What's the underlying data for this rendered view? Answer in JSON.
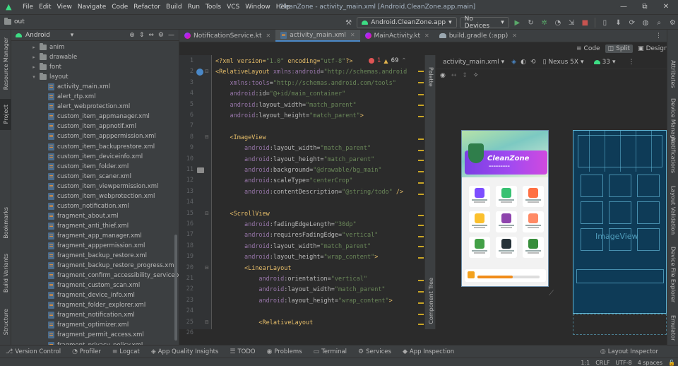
{
  "window": {
    "title": "CleanZone - activity_main.xml [Android.CleanZone.app.main]",
    "controls": [
      "—",
      "⧉",
      "✕"
    ]
  },
  "menu": [
    "File",
    "Edit",
    "View",
    "Navigate",
    "Code",
    "Refactor",
    "Build",
    "Run",
    "Tools",
    "VCS",
    "Window",
    "Help"
  ],
  "toolbar": {
    "project_name": "out",
    "run_config": "Android.CleanZone.app",
    "device": "No Devices"
  },
  "left_strip": [
    "Resource Manager",
    "Project",
    "Bookmarks",
    "Build Variants",
    "Structure"
  ],
  "right_strip": [
    "Attributes",
    "Device Manager",
    "Notifications",
    "Layout Validation",
    "Device File Explorer",
    "Emulator"
  ],
  "project": {
    "view_mode": "Android",
    "folders": [
      {
        "label": "anim",
        "expanded": false
      },
      {
        "label": "drawable",
        "expanded": false
      },
      {
        "label": "font",
        "expanded": false
      },
      {
        "label": "layout",
        "expanded": true
      }
    ],
    "files": [
      "activity_main.xml",
      "alert_rtp.xml",
      "alert_webprotection.xml",
      "custom_item_appmanager.xml",
      "custom_item_appnotif.xml",
      "custom_item_apppermission.xml",
      "custom_item_backuprestore.xml",
      "custom_item_deviceinfo.xml",
      "custom_item_folder.xml",
      "custom_item_scaner.xml",
      "custom_item_viewpermission.xml",
      "custom_item_webprotection.xml",
      "custom_notification.xml",
      "fragment_about.xml",
      "fragment_anti_thief.xml",
      "fragment_app_manager.xml",
      "fragment_apppermission.xml",
      "fragment_backup_restore.xml",
      "fragment_backup_restore_progress.xml",
      "fragment_confirm_accessibility_service.xml",
      "fragment_custom_scan.xml",
      "fragment_device_info.xml",
      "fragment_folder_explorer.xml",
      "fragment_notification.xml",
      "fragment_optimizer.xml",
      "fragment_permit_access.xml",
      "fragment_privacy_policy.xml"
    ]
  },
  "editor_tabs": [
    {
      "label": "NotificationService.kt",
      "icon": "kotlin-icon",
      "active": false
    },
    {
      "label": "activity_main.xml",
      "icon": "xml-icon",
      "active": true
    },
    {
      "label": "MainActivity.kt",
      "icon": "kotlin-icon",
      "active": false
    },
    {
      "label": "build.gradle (:app)",
      "icon": "gradle-icon",
      "active": false
    }
  ],
  "inspections": {
    "errors": "1",
    "warnings": "69"
  },
  "code_lines": [
    {
      "n": "1",
      "html": "<span class='t-pi'>&lt;?xml version=</span><span class='t-val'>\"1.0\"</span><span class='t-pi'> encoding=</span><span class='t-val'>\"utf-8\"</span><span class='t-pi'>?&gt;</span>"
    },
    {
      "n": "2",
      "html": "<span class='t-tag'>&lt;RelativeLayout </span><span class='t-ns'>xmlns:android</span><span class='t-attr'>=</span><span class='t-val'>\"http://schemas.android</span>"
    },
    {
      "n": "3",
      "html": "    <span class='t-ns'>xmlns:tools</span><span class='t-attr'>=</span><span class='t-val'>\"http://schemas.android.com/tools\"</span>"
    },
    {
      "n": "4",
      "html": "    <span class='t-ns'>android</span><span class='t-attr'>:id=</span><span class='t-val'>\"@+id/main_container\"</span>"
    },
    {
      "n": "5",
      "html": "    <span class='t-ns'>android</span><span class='t-attr'>:layout_width=</span><span class='t-val'>\"match_parent\"</span>"
    },
    {
      "n": "6",
      "html": "    <span class='t-ns'>android</span><span class='t-attr'>:layout_height=</span><span class='t-val'>\"match_parent\"</span><span class='t-tag'>&gt;</span>"
    },
    {
      "n": "7",
      "html": ""
    },
    {
      "n": "8",
      "html": "    <span class='t-tag'>&lt;ImageView</span>"
    },
    {
      "n": "9",
      "html": "        <span class='t-ns'>android</span><span class='t-attr'>:layout_width=</span><span class='t-val'>\"match_parent\"</span>"
    },
    {
      "n": "10",
      "html": "        <span class='t-ns'>android</span><span class='t-attr'>:layout_height=</span><span class='t-val'>\"match_parent\"</span>"
    },
    {
      "n": "11",
      "html": "        <span class='t-ns'>android</span><span class='t-attr'>:background=</span><span class='t-val'>\"@drawable/bg_main\"</span>"
    },
    {
      "n": "12",
      "html": "        <span class='t-ns'>android</span><span class='t-attr'>:scaleType=</span><span class='t-val'>\"centerCrop\"</span>"
    },
    {
      "n": "13",
      "html": "        <span class='t-ns'>android</span><span class='t-attr'>:contentDescription=</span><span class='t-val'>\"@string/todo\"</span> <span class='t-tag'>/&gt;</span>"
    },
    {
      "n": "14",
      "html": ""
    },
    {
      "n": "15",
      "html": "    <span class='t-tag'>&lt;ScrollView</span>"
    },
    {
      "n": "16",
      "html": "        <span class='t-ns'>android</span><span class='t-attr'>:fadingEdgeLength=</span><span class='t-val'>\"30dp\"</span>"
    },
    {
      "n": "17",
      "html": "        <span class='t-ns'>android</span><span class='t-attr'>:requiresFadingEdge=</span><span class='t-val'>\"vertical\"</span>"
    },
    {
      "n": "18",
      "html": "        <span class='t-ns'>android</span><span class='t-attr'>:layout_width=</span><span class='t-val'>\"match_parent\"</span>"
    },
    {
      "n": "19",
      "html": "        <span class='t-ns'>android</span><span class='t-attr'>:layout_height=</span><span class='t-val'>\"wrap_content\"</span><span class='t-tag'>&gt;</span>"
    },
    {
      "n": "20",
      "html": "        <span class='t-tag'>&lt;LinearLayout</span>"
    },
    {
      "n": "21",
      "html": "            <span class='t-ns'>android</span><span class='t-attr'>:orientation=</span><span class='t-val'>\"vertical\"</span>"
    },
    {
      "n": "22",
      "html": "            <span class='t-ns'>android</span><span class='t-attr'>:layout_width=</span><span class='t-val'>\"match_parent\"</span>"
    },
    {
      "n": "23",
      "html": "            <span class='t-ns'>android</span><span class='t-attr'>:layout_height=</span><span class='t-val'>\"wrap_content\"</span><span class='t-tag'>&gt;</span>"
    },
    {
      "n": "24",
      "html": ""
    },
    {
      "n": "25",
      "html": "            <span class='t-tag'>&lt;RelativeLayout</span>"
    },
    {
      "n": "26",
      "html": "                <span class='t-ns'>android</span><span class='t-attr'>:layout_width=</span><span class='t-val'>\"match_parent\"</span>"
    }
  ],
  "design": {
    "modes": [
      "Code",
      "Split",
      "Design"
    ],
    "active_mode": "Split",
    "file_dropdown": "activity_main.xml",
    "device": "Nexus 5X",
    "api": "33",
    "preview_app_name": "CleanZone",
    "blueprint_label": "ImageView"
  },
  "side_labels": {
    "palette": "Palette",
    "component_tree": "Component Tree"
  },
  "bottom_tools": [
    {
      "label": "Version Control",
      "icon": "⎇"
    },
    {
      "label": "Profiler",
      "icon": "◔"
    },
    {
      "label": "Logcat",
      "icon": "≡"
    },
    {
      "label": "App Quality Insights",
      "icon": "◈"
    },
    {
      "label": "TODO",
      "icon": "☰"
    },
    {
      "label": "Problems",
      "icon": "◉"
    },
    {
      "label": "Terminal",
      "icon": "▭"
    },
    {
      "label": "Services",
      "icon": "⚙"
    },
    {
      "label": "App Inspection",
      "icon": "◆"
    }
  ],
  "layout_inspector": "Layout Inspector",
  "status": {
    "position": "1:1",
    "line_sep": "CRLF",
    "encoding": "UTF-8",
    "indent": "4 spaces"
  },
  "colors": {
    "accent": "#4a88c7",
    "android_green": "#3ddc84",
    "banner": "#a14af0"
  }
}
